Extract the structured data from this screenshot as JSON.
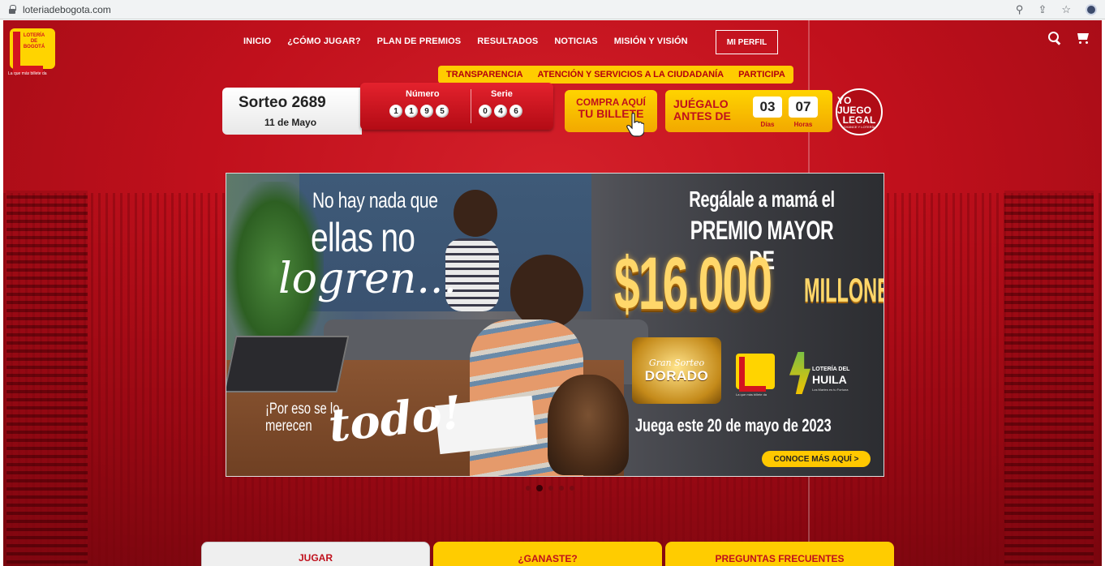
{
  "browser": {
    "url": "loteriadebogota.com"
  },
  "logo": {
    "name": "LOTERÍA DE BOGOTÁ",
    "tagline": "La que más billete da"
  },
  "nav": {
    "items": [
      "INICIO",
      "¿CÓMO JUGAR?",
      "PLAN DE PREMIOS",
      "RESULTADOS",
      "NOTICIAS",
      "MISIÓN Y VISIÓN"
    ],
    "profile": "MI PERFIL"
  },
  "subnav": {
    "items": [
      "TRANSPARENCIA",
      "ATENCIÓN Y SERVICIOS A LA CIUDADANÍA",
      "PARTICIPA"
    ]
  },
  "draw": {
    "title": "Sorteo 2689",
    "date": "11 de Mayo",
    "numero_label": "Número",
    "serie_label": "Serie",
    "numero": [
      "1",
      "1",
      "9",
      "5"
    ],
    "serie": [
      "0",
      "4",
      "6"
    ]
  },
  "buy": {
    "line1": "COMPRA AQUÍ",
    "line2": "TU BILLETE"
  },
  "countdown": {
    "line1": "JUÉGALO",
    "line2": "ANTES DE",
    "days": "03",
    "hours": "07",
    "days_label": "Días",
    "hours_label": "Horas"
  },
  "yojuego": {
    "line1": "YO JUEGO",
    "line2": "LEGAL",
    "line3": "CHANCE Y LOTERÍA"
  },
  "banner": {
    "left_line1": "No hay nada que",
    "left_line2": "ellas no",
    "left_line3": "logren...",
    "left_line4": "¡Por eso se lo",
    "left_line5": "merecen",
    "left_line6": "todo!",
    "right_line1": "Regálale a mamá el",
    "right_line2": "PREMIO MAYOR DE",
    "amount": "$16.000",
    "amount_unit": "MILLONES",
    "badge_top": "Gran Sorteo",
    "badge_main": "DORADO",
    "logo_tag": "La que más billete da",
    "huila_line1": "LOTERÍA DEL",
    "huila_line2": "HUILA",
    "huila_line3": "Los Martes es tu Fortuna",
    "date_text": "Juega este 20 de mayo de 2023",
    "cta": "CONOCE MÁS AQUÍ >"
  },
  "carousel": {
    "count": 5,
    "active": 2
  },
  "tabs": [
    "JUGAR",
    "¿GANASTE?",
    "PREGUNTAS FRECUENTES"
  ],
  "colors": {
    "brand_red": "#d3141f",
    "brand_yellow": "#ffcc00"
  }
}
